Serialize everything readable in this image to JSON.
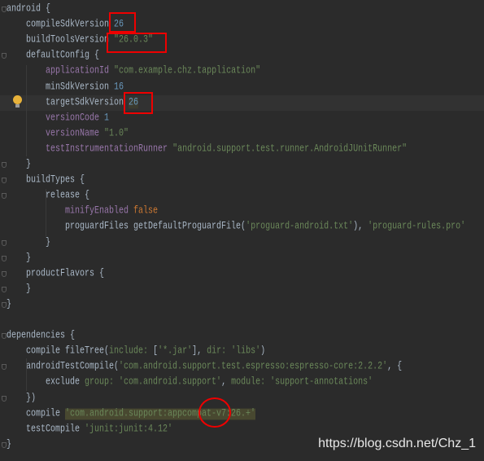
{
  "editor": {
    "language": "gradle",
    "current_line": 7,
    "lines": [
      [
        [
          "p",
          "android {"
        ]
      ],
      [
        [
          "p",
          "    compileSdkVersion "
        ],
        [
          "n",
          "26"
        ]
      ],
      [
        [
          "p",
          "    buildToolsVersion "
        ],
        [
          "s",
          "\"26.0.3\""
        ]
      ],
      [
        [
          "p",
          "    defaultConfig {"
        ]
      ],
      [
        [
          "p",
          "        "
        ],
        [
          "k",
          "applicationId"
        ],
        [
          "p",
          " "
        ],
        [
          "s",
          "\"com.example.chz.tapplication\""
        ]
      ],
      [
        [
          "p",
          "        minSdkVersion "
        ],
        [
          "n",
          "16"
        ]
      ],
      [
        [
          "p",
          "        targetSdkVersion "
        ],
        [
          "n",
          "26"
        ]
      ],
      [
        [
          "p",
          "        "
        ],
        [
          "k",
          "versionCode"
        ],
        [
          "p",
          " "
        ],
        [
          "n",
          "1"
        ]
      ],
      [
        [
          "p",
          "        "
        ],
        [
          "k",
          "versionName"
        ],
        [
          "p",
          " "
        ],
        [
          "s",
          "\"1.0\""
        ]
      ],
      [
        [
          "p",
          "        "
        ],
        [
          "k",
          "testInstrumentationRunner"
        ],
        [
          "p",
          " "
        ],
        [
          "s",
          "\"android.support.test.runner.AndroidJUnitRunner\""
        ]
      ],
      [
        [
          "p",
          "    }"
        ]
      ],
      [
        [
          "p",
          "    buildTypes {"
        ]
      ],
      [
        [
          "p",
          "        release {"
        ]
      ],
      [
        [
          "p",
          "            "
        ],
        [
          "k",
          "minifyEnabled"
        ],
        [
          "p",
          " "
        ],
        [
          "o",
          "false"
        ]
      ],
      [
        [
          "p",
          "            proguardFiles getDefaultProguardFile("
        ],
        [
          "s",
          "'proguard-android.txt'"
        ],
        [
          "p",
          "), "
        ],
        [
          "s",
          "'proguard-rules.pro'"
        ]
      ],
      [
        [
          "p",
          "        }"
        ]
      ],
      [
        [
          "p",
          "    }"
        ]
      ],
      [
        [
          "p",
          "    productFlavors {"
        ]
      ],
      [
        [
          "p",
          "    }"
        ]
      ],
      [
        [
          "p",
          "}"
        ]
      ],
      [
        [
          "p",
          ""
        ]
      ],
      [
        [
          "p",
          "dependencies {"
        ]
      ],
      [
        [
          "p",
          "    compile fileTree("
        ],
        [
          "g",
          "include: "
        ],
        [
          "p",
          "["
        ],
        [
          "s",
          "'*.jar'"
        ],
        [
          "p",
          "], "
        ],
        [
          "g",
          "dir: "
        ],
        [
          "s",
          "'libs'"
        ],
        [
          "p",
          ")"
        ]
      ],
      [
        [
          "p",
          "    androidTestCompile("
        ],
        [
          "s",
          "'com.android.support.test.espresso:espresso-core:2.2.2'"
        ],
        [
          "p",
          ", {"
        ]
      ],
      [
        [
          "p",
          "        exclude "
        ],
        [
          "g",
          "group: "
        ],
        [
          "s",
          "'com.android.support'"
        ],
        [
          "p",
          ", "
        ],
        [
          "g",
          "module: "
        ],
        [
          "s",
          "'support-annotations'"
        ]
      ],
      [
        [
          "p",
          "    })"
        ]
      ],
      [
        [
          "p",
          "    compile "
        ],
        [
          "s hl",
          "'com.android.support:appcompat-v7:26.+'"
        ]
      ],
      [
        [
          "p",
          "    testCompile "
        ],
        [
          "s",
          "'junit:junit:4.12'"
        ]
      ],
      [
        [
          "p",
          "}"
        ]
      ]
    ]
  },
  "gutter": {
    "intention_icon": "lightbulb-icon"
  },
  "watermark": "https://blog.csdn.net/Chz_1",
  "colors": {
    "background": "#2b2b2b",
    "text": "#a9b7c6",
    "number": "#6897bb",
    "string": "#6a8759",
    "property": "#9876aa",
    "keyword": "#cc7832",
    "annotation": "#ee0000"
  }
}
